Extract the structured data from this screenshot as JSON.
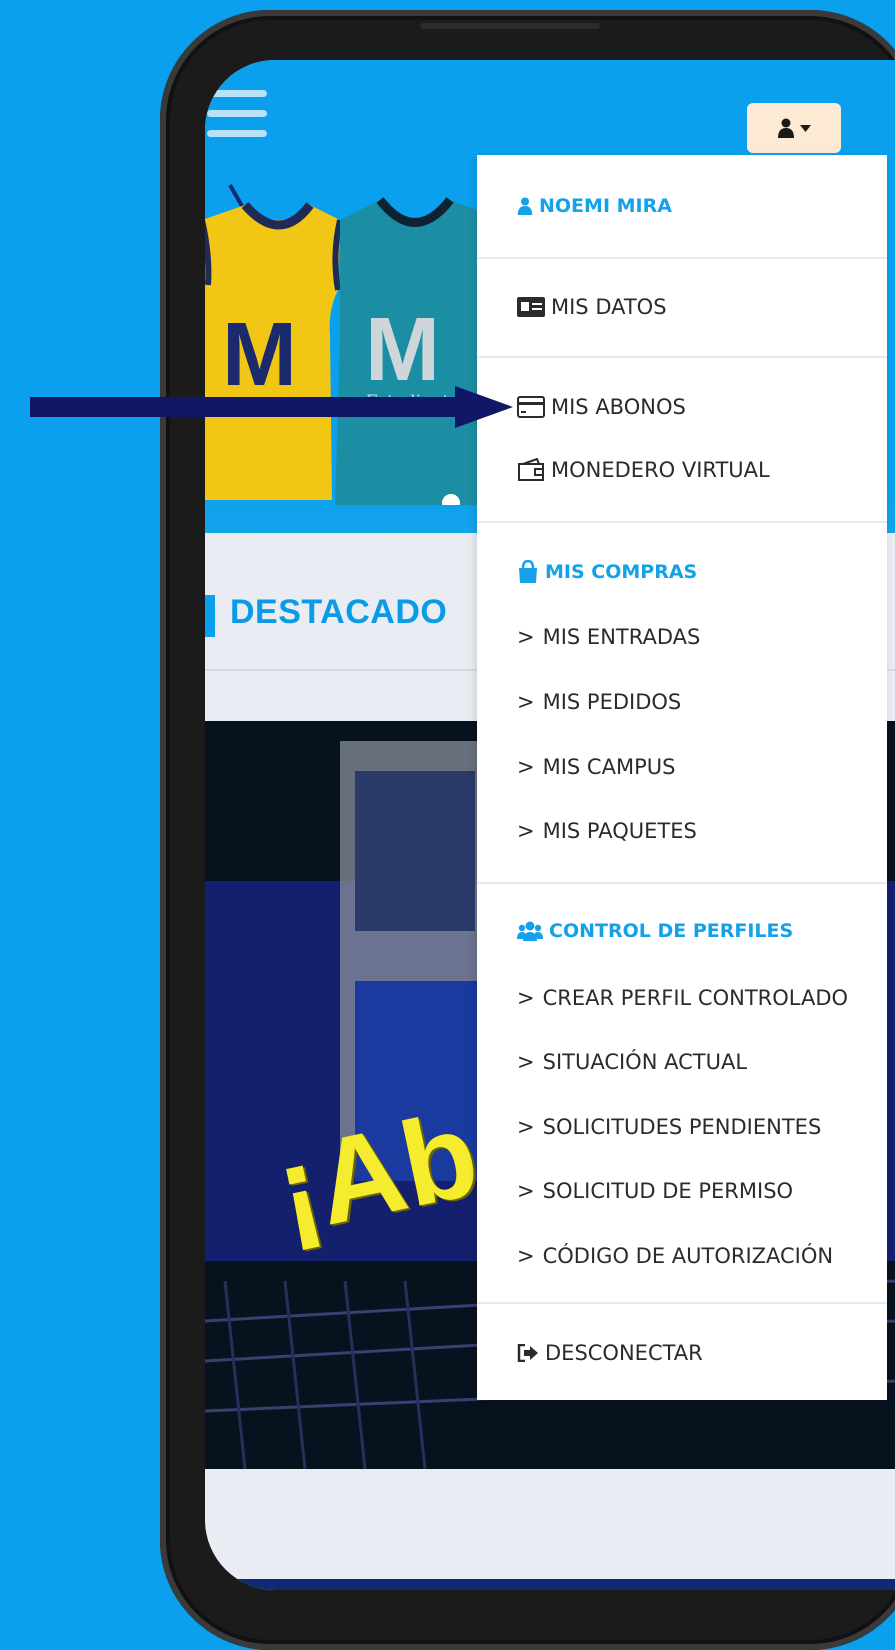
{
  "user_menu": {
    "user_name": "NOEMI MIRA",
    "mis_datos": "MIS DATOS",
    "mis_abonos": "MIS ABONOS",
    "monedero_virtual": "MONEDERO VIRTUAL",
    "mis_compras": "MIS COMPRAS",
    "compras_items": [
      "MIS ENTRADAS",
      "MIS PEDIDOS",
      "MIS CAMPUS",
      "MIS PAQUETES"
    ],
    "control_perfiles": "CONTROL DE PERFILES",
    "perfiles_items": [
      "CREAR PERFIL CONTROLADO",
      "SITUACIÓN ACTUAL",
      "SOLICITUDES PENDIENTES",
      "SOLICITUD DE PERMISO",
      "CÓDIGO DE AUTORIZACIÓN"
    ],
    "desconectar": "DESCONECTAR",
    "chevron": ">"
  },
  "main": {
    "section_title": "DESTACADO",
    "promo_text": "¡Abó",
    "jersey_brand": "Estudiantes"
  },
  "icons": {
    "menu": "hamburger-icon",
    "user": "user-icon",
    "caret": "caret-down-icon",
    "id_card": "id-card-icon",
    "card": "credit-card-icon",
    "wallet": "wallet-icon",
    "bag": "shopping-bag-icon",
    "users": "users-icon",
    "signout": "sign-out-icon",
    "arrow": "pointer-arrow"
  },
  "colors": {
    "background": "#0AA0EE",
    "accent": "#14A1EA",
    "arrow": "#111766",
    "jersey_yellow": "#F1C615",
    "jersey_teal": "#1C8EA4"
  }
}
